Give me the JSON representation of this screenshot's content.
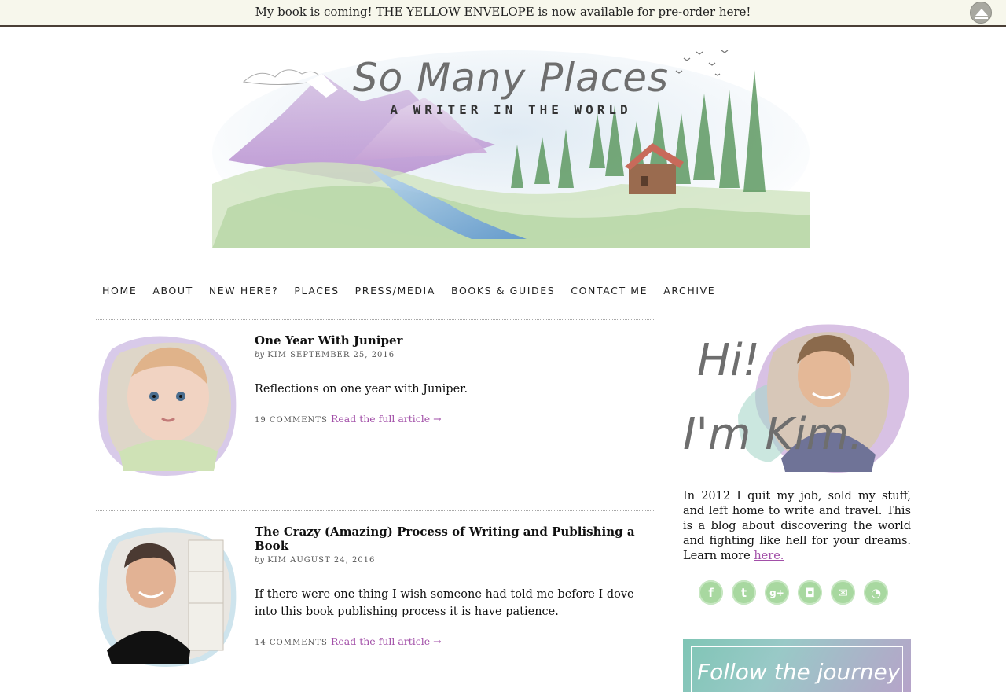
{
  "announcement": {
    "text": "My book is coming! THE YELLOW ENVELOPE is now available for pre-order ",
    "link": "here!"
  },
  "site": {
    "title": "So Many Places",
    "tagline": "A WRITER IN THE WORLD"
  },
  "nav": [
    "HOME",
    "ABOUT",
    "NEW HERE?",
    "PLACES",
    "PRESS/MEDIA",
    "BOOKS & GUIDES",
    "CONTACT ME",
    "ARCHIVE"
  ],
  "posts": [
    {
      "title": "One Year With Juniper",
      "by": "by",
      "author": "KIM",
      "date": "SEPTEMBER 25, 2016",
      "excerpt": "Reflections on one year with Juniper.",
      "comments": "19 COMMENTS",
      "read_more": "Read the full article →"
    },
    {
      "title": "The Crazy (Amazing) Process of Writing and Publishing a Book",
      "by": "by",
      "author": "KIM",
      "date": "AUGUST 24, 2016",
      "excerpt": "If there were one thing I wish someone had told me before I dove into this book publishing process it is have patience.",
      "comments": "14 COMMENTS",
      "read_more": "Read the full article →"
    }
  ],
  "sidebar": {
    "hi_line1": "Hi!",
    "hi_line2": "I'm Kim.",
    "bio": "In 2012 I quit my job, sold my stuff, and left home to write and travel. This is a blog about discovering the world and fighting like hell for your dreams. Learn more ",
    "bio_link": "here.",
    "social": [
      {
        "name": "facebook-icon",
        "glyph": "f"
      },
      {
        "name": "twitter-icon",
        "glyph": "t"
      },
      {
        "name": "google-plus-icon",
        "glyph": "g+"
      },
      {
        "name": "instagram-icon",
        "glyph": "◘"
      },
      {
        "name": "email-icon",
        "glyph": "✉"
      },
      {
        "name": "rss-icon",
        "glyph": "◔"
      }
    ],
    "follow_text": "Follow the journey"
  }
}
